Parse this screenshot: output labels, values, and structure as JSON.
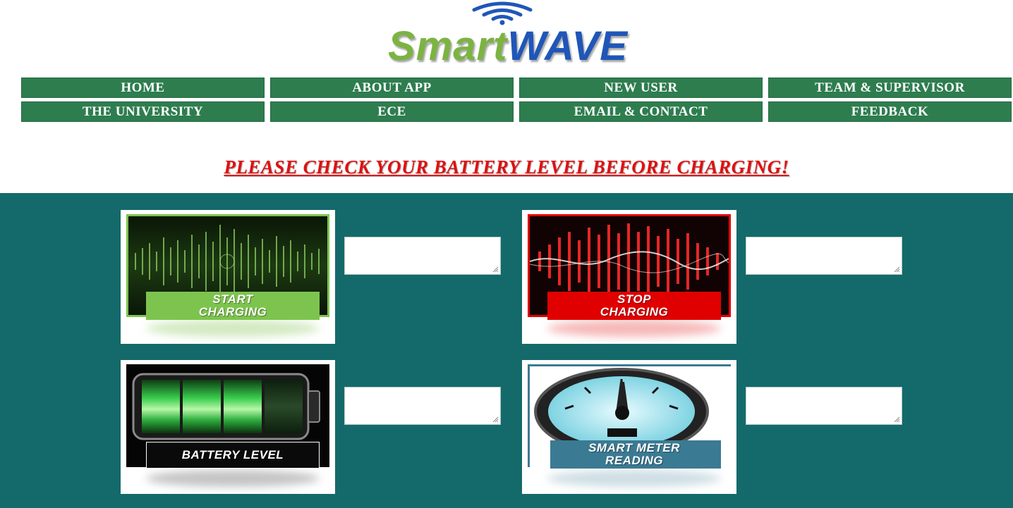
{
  "brand": {
    "part1": "Smart",
    "part2": "WAVE"
  },
  "nav": {
    "row1": [
      "HOME",
      "ABOUT APP",
      "NEW USER",
      "TEAM & SUPERVISOR"
    ],
    "row2": [
      "THE UNIVERSITY",
      "ECE",
      "EMAIL & CONTACT",
      "FEEDBACK"
    ]
  },
  "warning": "PLEASE CHECK YOUR BATTERY LEVEL BEFORE CHARGING!",
  "controls": {
    "start": {
      "line1": "START",
      "line2": "CHARGING",
      "value": ""
    },
    "stop": {
      "line1": "STOP",
      "line2": "CHARGING",
      "value": ""
    },
    "battery": {
      "label": "BATTERY LEVEL",
      "value": ""
    },
    "meter": {
      "line1": "SMART METER",
      "line2": "READING",
      "value": ""
    }
  },
  "colors": {
    "nav": "#2e7d4f",
    "panel": "#146a6a",
    "warning": "#e01010",
    "start": "#7dc44e",
    "stop": "#e00000",
    "meter_label": "#3b7a93"
  },
  "icons": [
    "wifi-icon",
    "sound-wave-green",
    "sound-wave-red",
    "battery-icon",
    "gauge-icon"
  ]
}
